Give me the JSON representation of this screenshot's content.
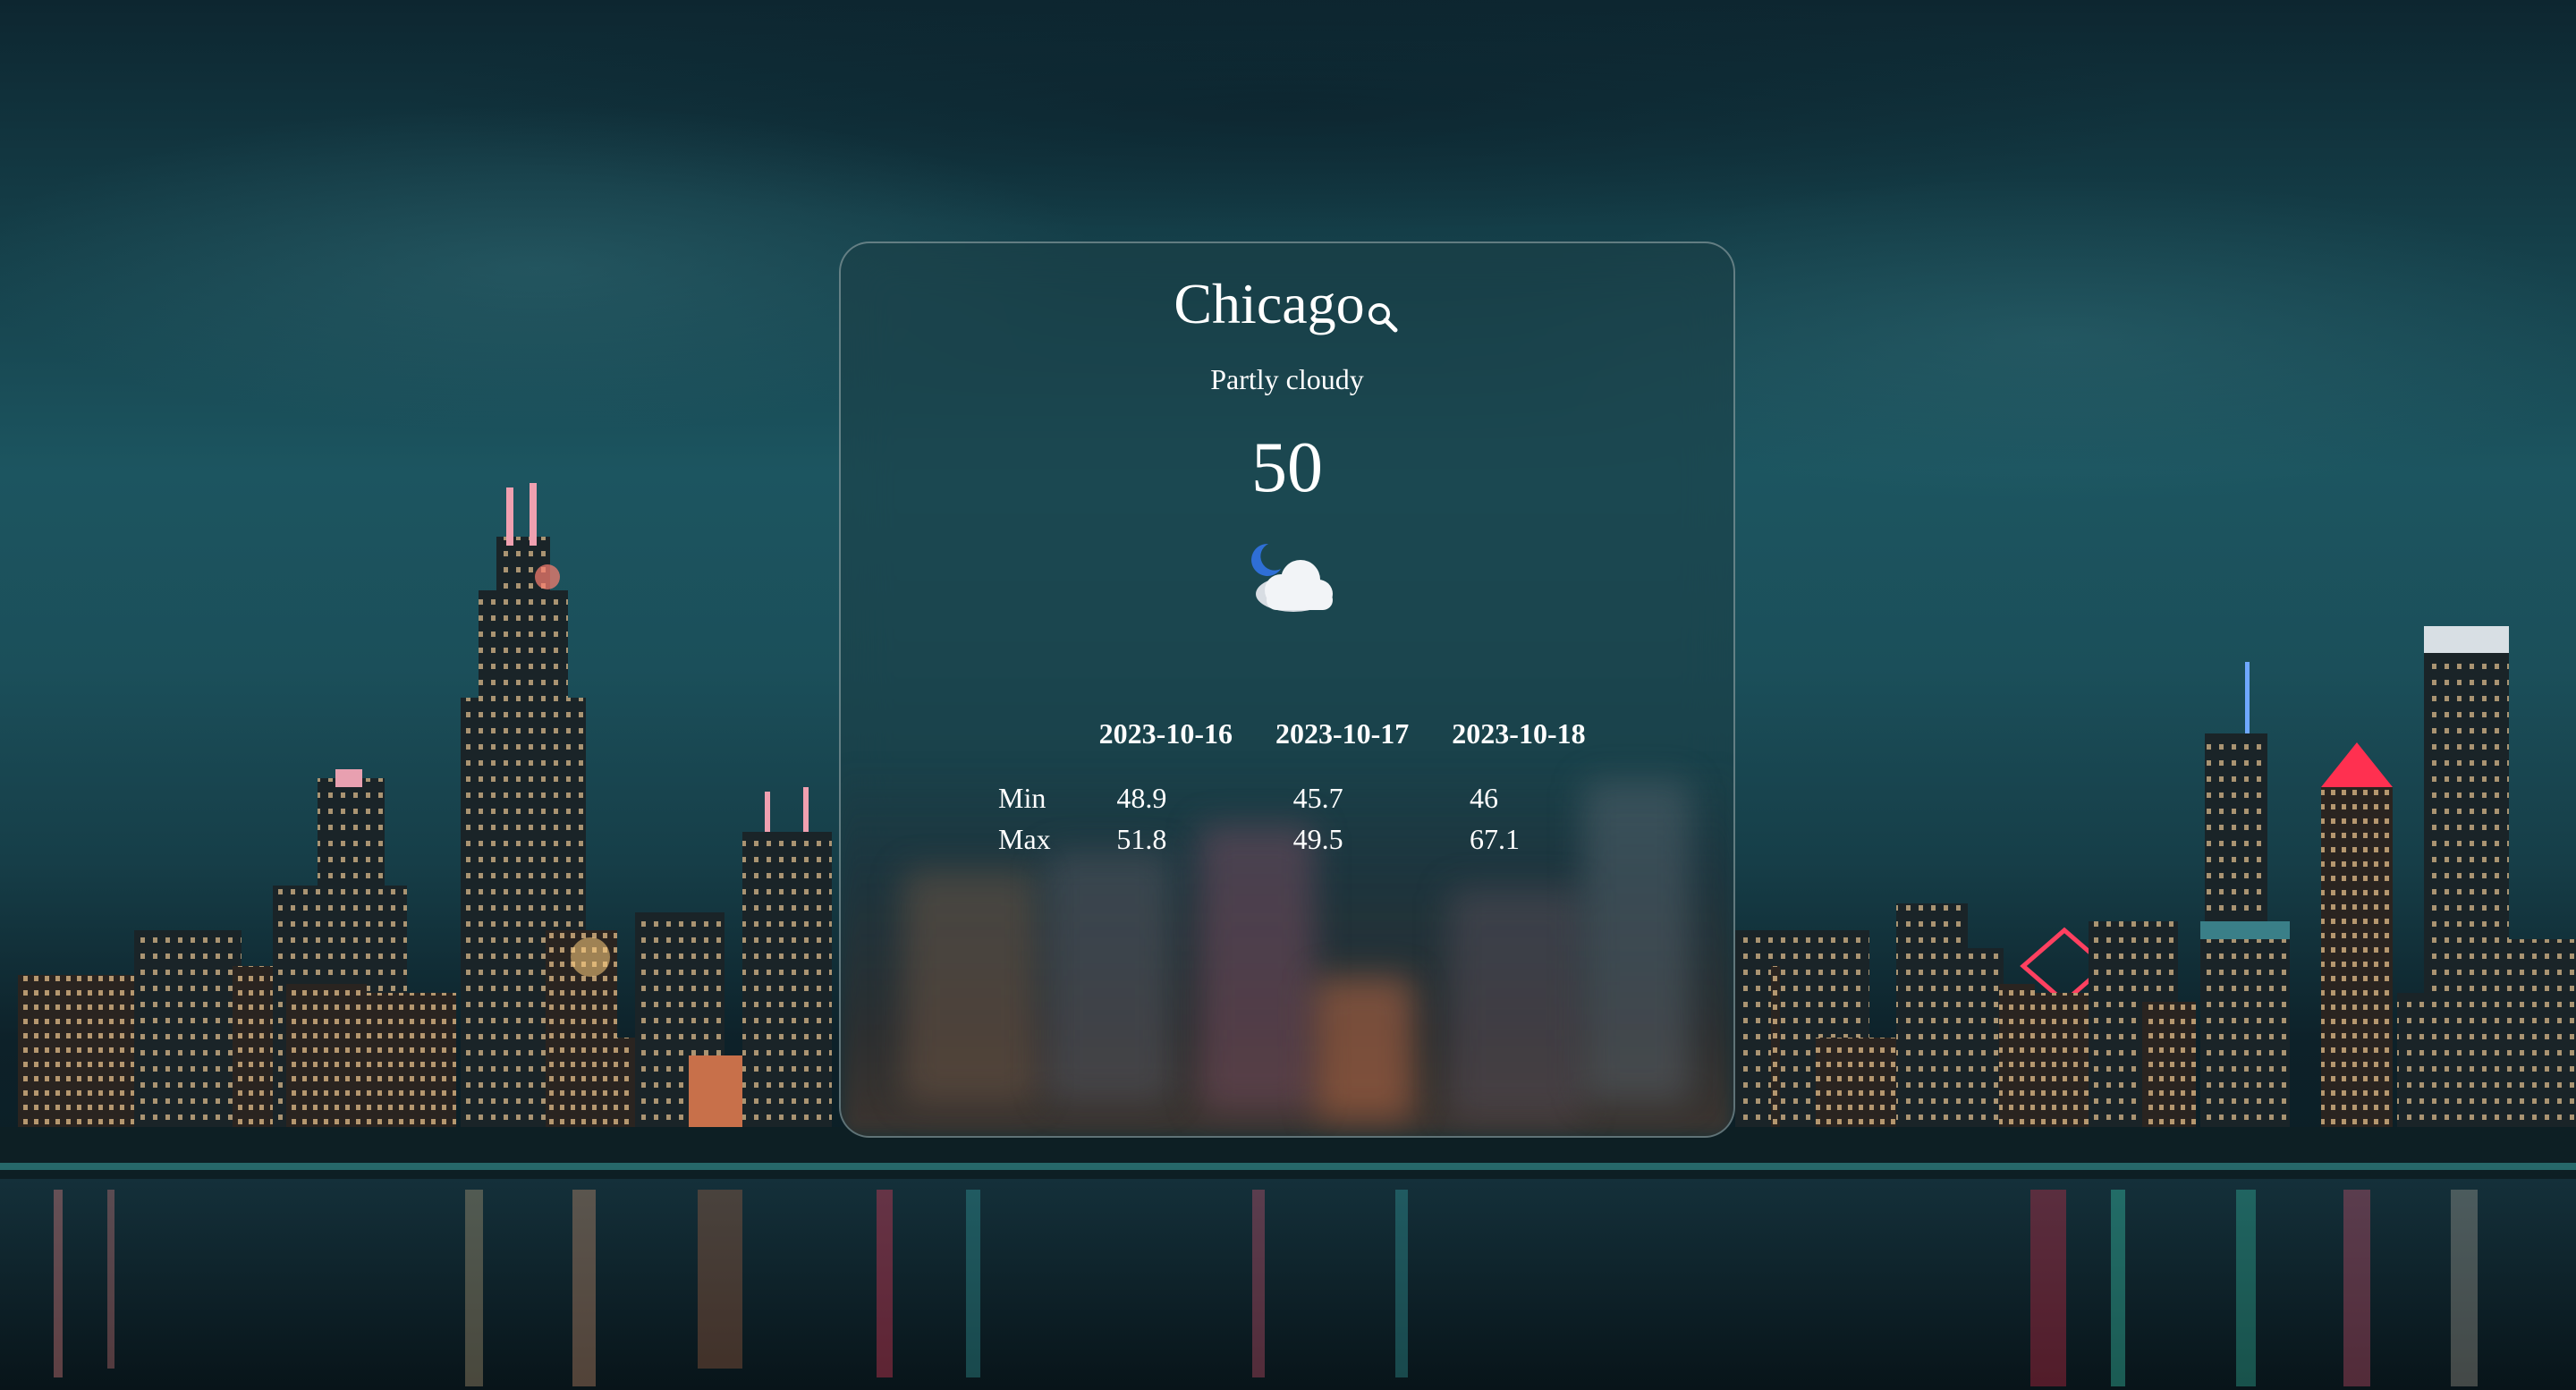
{
  "weather": {
    "city": "Chicago",
    "condition": "Partly cloudy",
    "temperature": "50",
    "icon": "moon-partly-cloudy-icon",
    "search_icon": "search-icon"
  },
  "forecast": {
    "dates": [
      "2023-10-16",
      "2023-10-17",
      "2023-10-18"
    ],
    "rows": [
      {
        "label": "Min",
        "values": [
          "48.9",
          "45.7",
          "46"
        ]
      },
      {
        "label": "Max",
        "values": [
          "51.8",
          "49.5",
          "67.1"
        ]
      }
    ]
  },
  "colors": {
    "text": "#ffffff",
    "moon": "#2f6fd6",
    "cloud": "#f2f4f7"
  }
}
